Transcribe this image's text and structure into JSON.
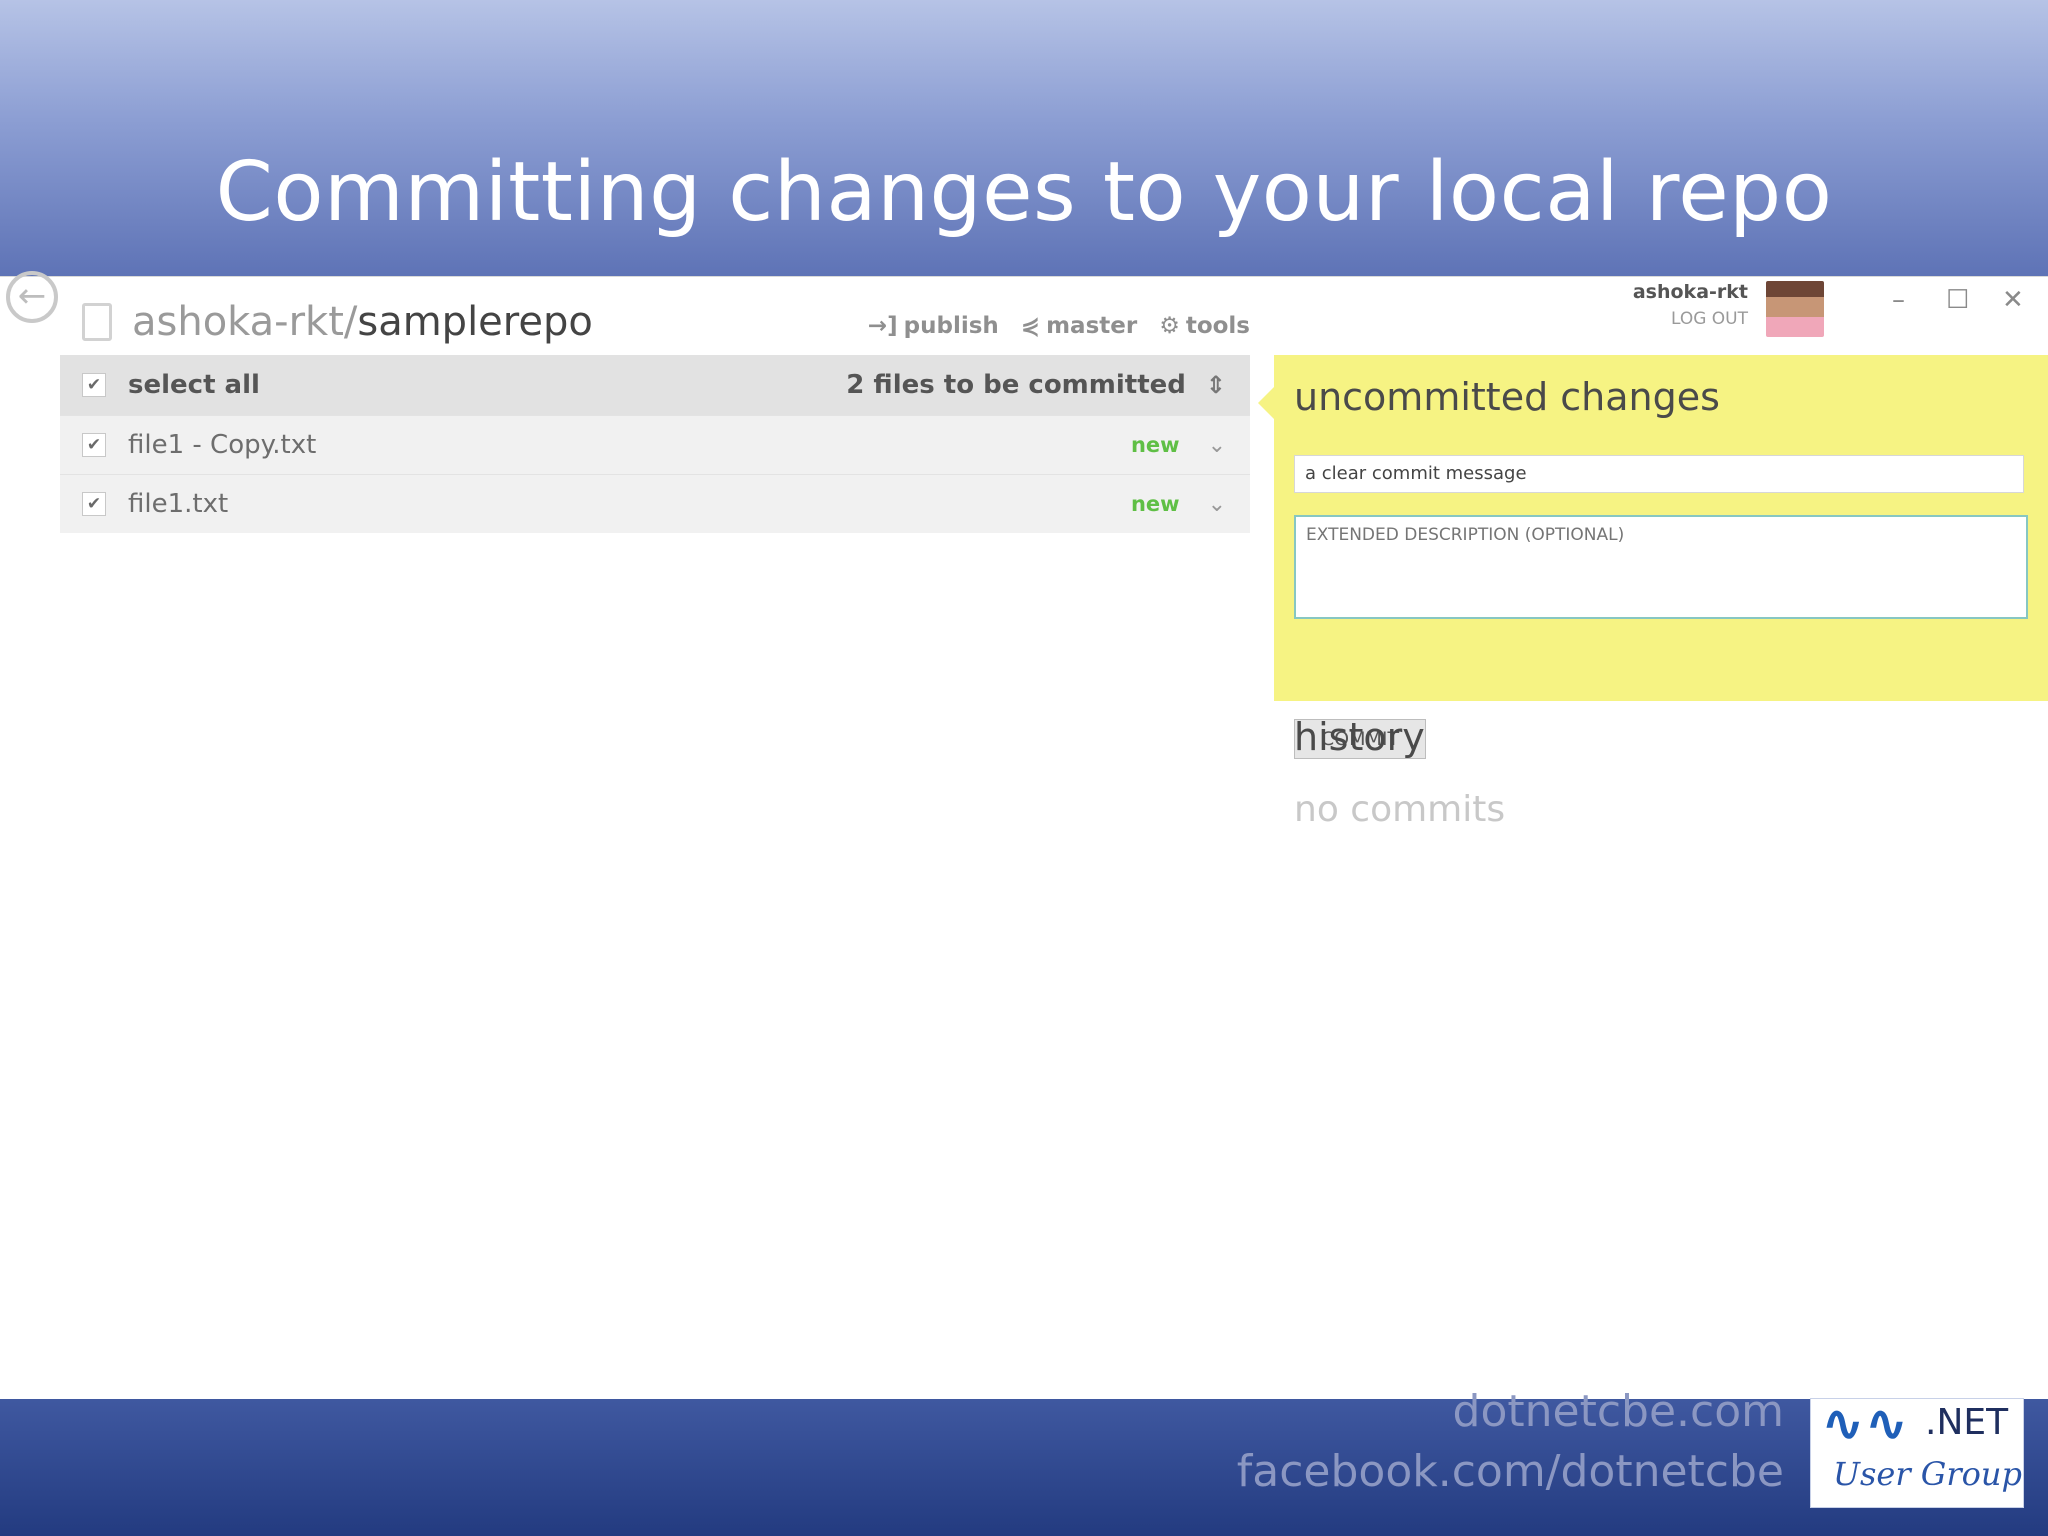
{
  "slide": {
    "title": "Committing changes to your local repo"
  },
  "app": {
    "repo_owner": "ashoka-rkt/",
    "repo_name": "samplerepo",
    "toolbar": {
      "publish": "publish",
      "branch": "master",
      "tools": "tools"
    },
    "user": {
      "name": "ashoka-rkt",
      "logout": "LOG OUT"
    },
    "window_controls": {
      "minimize": "–",
      "maximize": "☐",
      "close": "✕"
    },
    "files": {
      "select_all": "select all",
      "count_label": "2 files to be committed",
      "rows": [
        {
          "name": "file1 - Copy.txt",
          "status": "new",
          "checked": true
        },
        {
          "name": "file1.txt",
          "status": "new",
          "checked": true
        }
      ]
    },
    "commit": {
      "heading": "uncommitted changes",
      "summary_value": "a clear commit message",
      "description_placeholder": "EXTENDED DESCRIPTION (OPTIONAL)",
      "button_label": "COMMIT"
    },
    "history": {
      "heading": "history",
      "empty_text": "no commits"
    }
  },
  "footer": {
    "site": "dotnetcbe.com",
    "facebook": "facebook.com/dotnetcbe",
    "logo_net": ".NET",
    "logo_group": "User Group"
  },
  "colors": {
    "commit_panel": "#f6f383",
    "status_new": "#5fbf45",
    "slide_bg_top": "#b6c3e6",
    "slide_bg_bottom": "#233b80"
  }
}
